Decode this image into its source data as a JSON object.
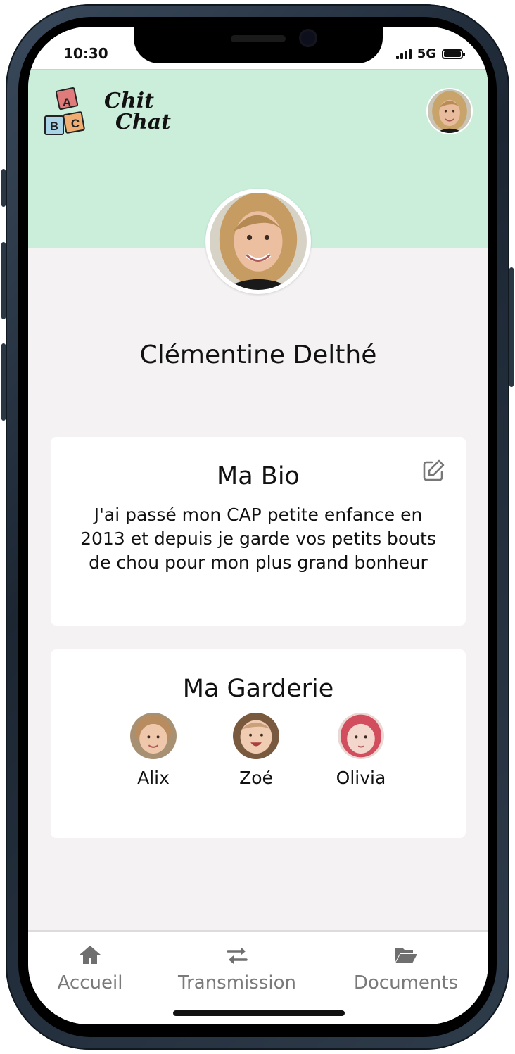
{
  "status_bar": {
    "time": "10:30",
    "network": "5G"
  },
  "header": {
    "logo": {
      "blocks": [
        "A",
        "B",
        "C"
      ],
      "text_line1": "Chit",
      "text_line2": "Chat"
    },
    "avatar_icon": "user-avatar"
  },
  "profile": {
    "name": "Clémentine Delthé"
  },
  "bio": {
    "title": "Ma Bio",
    "edit_icon": "edit-icon",
    "text": "J'ai passé mon CAP petite enfance en 2013 et depuis je garde vos petits bouts de chou pour mon plus grand bonheur"
  },
  "garderie": {
    "title": "Ma Garderie",
    "children": [
      {
        "name": "Alix"
      },
      {
        "name": "Zoé"
      },
      {
        "name": "Olivia"
      }
    ]
  },
  "bottom_nav": {
    "items": [
      {
        "label": "Accueil",
        "icon": "home-icon"
      },
      {
        "label": "Transmission",
        "icon": "transfer-icon"
      },
      {
        "label": "Documents",
        "icon": "folder-open-icon"
      }
    ]
  },
  "colors": {
    "header_background": "#cbeedb",
    "page_background": "#f4f2f3",
    "card_background": "#ffffff",
    "nav_text": "#7a7a7a"
  }
}
